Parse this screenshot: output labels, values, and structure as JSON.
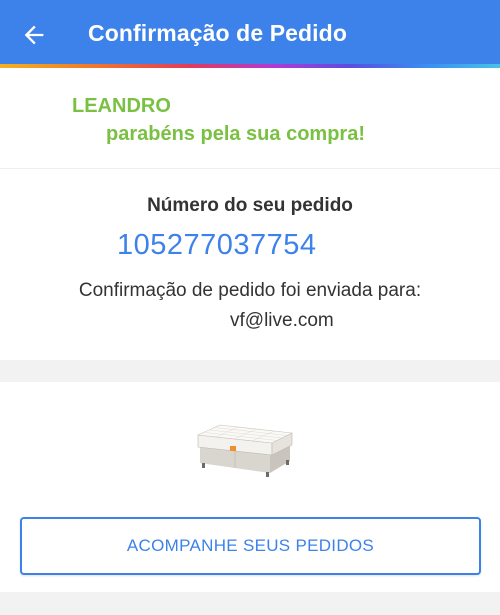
{
  "header": {
    "title": "Confirmação de Pedido",
    "back_icon": "arrow-left-icon"
  },
  "greeting": {
    "name": "LEANDRO",
    "message": "parabéns pela sua compra!"
  },
  "order": {
    "label": "Número do seu pedido",
    "number": "105277037754",
    "confirmation_text": "Confirmação de pedido foi enviada para:",
    "email": "vf@live.com"
  },
  "product": {
    "image_icon": "box-spring-bed-image"
  },
  "actions": {
    "track_orders_label": "ACOMPANHE SEUS PEDIDOS"
  },
  "colors": {
    "primary": "#3d82ea",
    "success_green": "#7ac143",
    "text_dark": "#333333",
    "background_gray": "#f2f2f2"
  }
}
